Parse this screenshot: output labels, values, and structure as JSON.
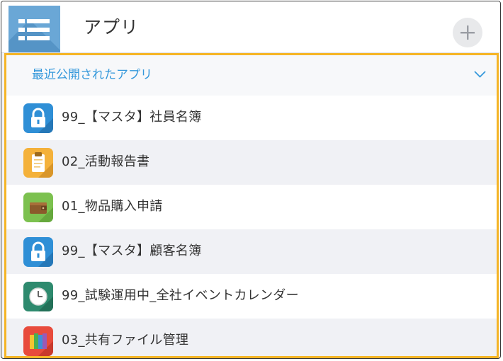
{
  "header": {
    "title": "アプリ",
    "menu_icon": "menu-list-icon",
    "add_icon": "plus-icon"
  },
  "recent": {
    "label": "最近公開されたアプリ",
    "toggle_icon": "chevron-down-icon",
    "accent": "#3498db",
    "highlight_border": "#f5b526"
  },
  "apps": [
    {
      "name": "99_【マスタ】社員名簿",
      "icon": "lock-icon",
      "color": "#2f8fd6"
    },
    {
      "name": "02_活動報告書",
      "icon": "clipboard-icon",
      "color": "#f4b13a"
    },
    {
      "name": "01_物品購入申請",
      "icon": "wallet-icon",
      "color": "#7cc14f"
    },
    {
      "name": "99_【マスタ】顧客名簿",
      "icon": "lock-icon",
      "color": "#2f8fd6"
    },
    {
      "name": "99_試験運用中_全社イベントカレンダー",
      "icon": "clock-icon",
      "color": "#2e8a6e"
    },
    {
      "name": "03_共有ファイル管理",
      "icon": "binders-icon",
      "color": "#e84b3c"
    }
  ]
}
